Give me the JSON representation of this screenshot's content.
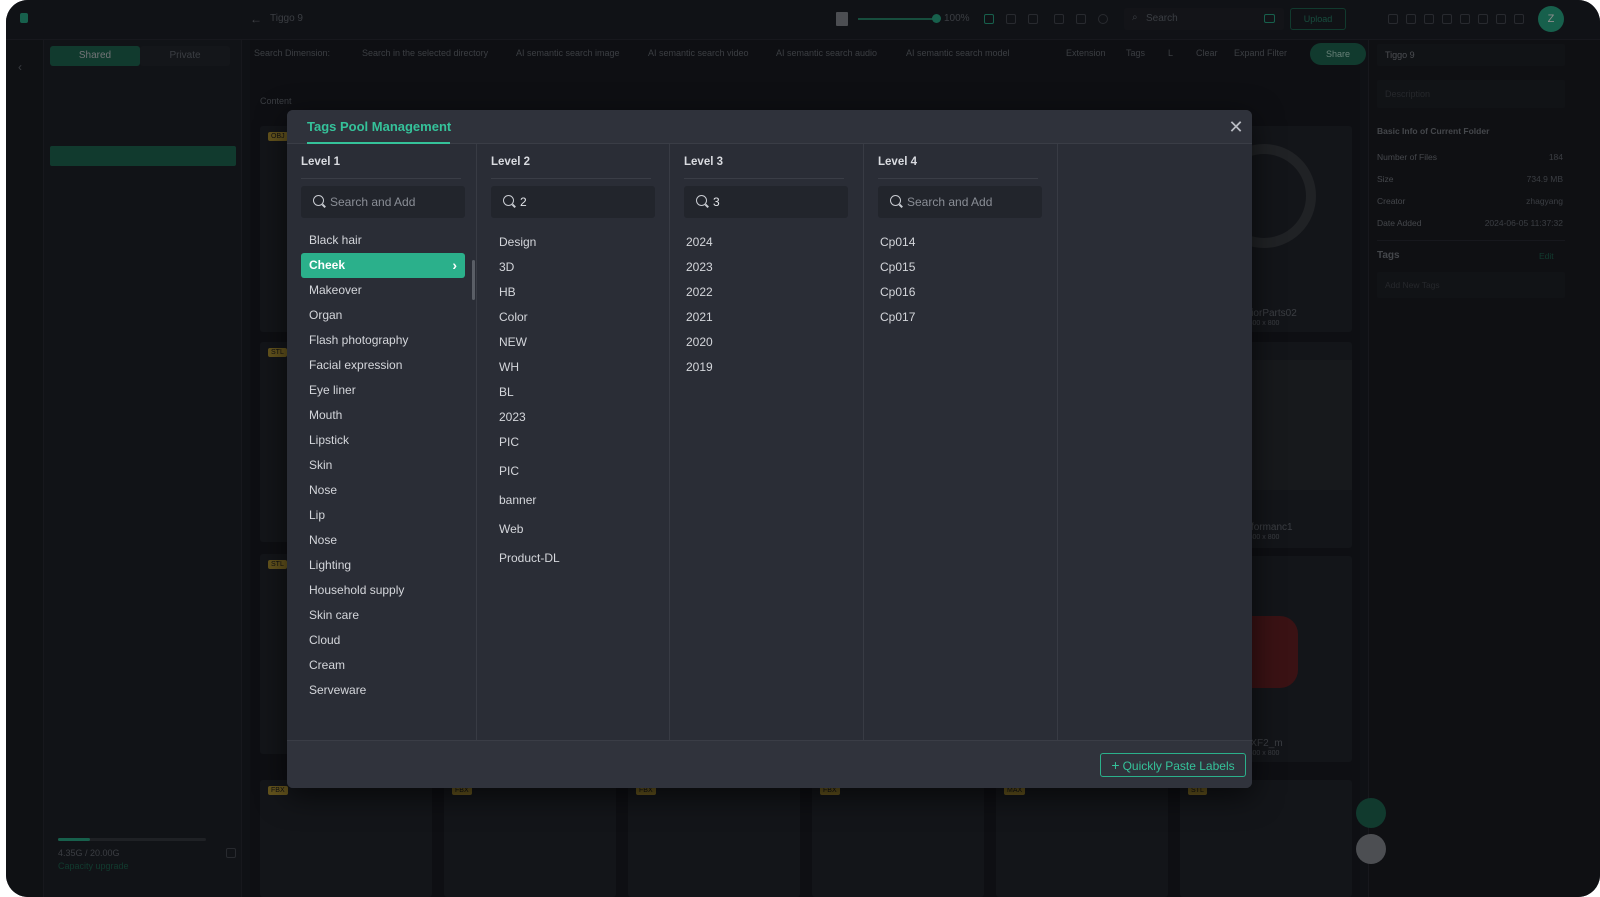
{
  "app": {
    "folder_title": "Tiggo 9",
    "zoom": "100%",
    "search_placeholder": "Search",
    "upload_label": "Upload",
    "avatar_letter": "Z",
    "tabs": {
      "shared": "Shared",
      "private": "Private"
    },
    "search_dimension_label": "Search Dimension:",
    "search_options": [
      "Search in the selected directory",
      "AI semantic search image",
      "AI semantic search video",
      "AI semantic search audio",
      "AI semantic search model"
    ],
    "filter_options": [
      "Extension",
      "Tags",
      "L"
    ],
    "clear_label": "Clear",
    "expand_filter_label": "Expand Filter",
    "share_label": "Share",
    "content_label": "Content",
    "storage_text": "4.35G / 20.00G",
    "storage_fraction": 0.218,
    "capacity_upgrade": "Capacity upgrade",
    "thumbnails": [
      {
        "name": "InteriorParts02",
        "size": "800 x 800"
      },
      {
        "name": "Performanc1",
        "size": "800 x 800"
      },
      {
        "name": "JXF2_m",
        "size": "800 x 800"
      }
    ],
    "thumb_badges": [
      "OBJ",
      "STL",
      "STL",
      "FBX",
      "FBX",
      "FBX",
      "FBX",
      "MAX",
      "STL"
    ]
  },
  "right_panel": {
    "folder_name": "Tiggo 9",
    "description_placeholder": "Description",
    "basic_info_title": "Basic Info of Current Folder",
    "info": [
      {
        "label": "Number of Files",
        "value": "184"
      },
      {
        "label": "Size",
        "value": "734.9 MB"
      },
      {
        "label": "Creator",
        "value": "zhagyang"
      },
      {
        "label": "Date Added",
        "value": "2024-06-05 11:37:32"
      }
    ],
    "tags_title": "Tags",
    "edit_label": "Edit",
    "add_tags_placeholder": "Add New Tags"
  },
  "modal": {
    "title": "Tags Pool Management",
    "paste_button": "Quickly Paste Labels",
    "columns": [
      {
        "header": "Level 1",
        "search_value": "",
        "search_placeholder": "Search and Add",
        "items": [
          "Black hair",
          "Cheek",
          "Makeover",
          "Organ",
          "Flash photography",
          "Facial expression",
          "Eye liner",
          "Mouth",
          "Lipstick",
          "Skin",
          "Nose",
          "Lip",
          "Nose",
          "Lighting",
          "Household supply",
          "Skin care",
          "Cloud",
          "Cream",
          "Serveware"
        ],
        "selected_index": 1
      },
      {
        "header": "Level 2",
        "search_value": "2",
        "search_placeholder": "Search and Add",
        "items": [
          "Design",
          "3D",
          "HB",
          "Color",
          "NEW",
          "WH",
          "BL",
          "2023",
          "PIC",
          "PIC",
          "banner",
          "Web",
          "Product-DL"
        ]
      },
      {
        "header": "Level 3",
        "search_value": "3",
        "search_placeholder": "Search and Add",
        "items": [
          "2024",
          "2023",
          "2022",
          "2021",
          "2020",
          "2019"
        ]
      },
      {
        "header": "Level 4",
        "search_value": "",
        "search_placeholder": "Search and Add",
        "items": [
          "Cp014",
          "Cp015",
          "Cp016",
          "Cp017"
        ]
      }
    ]
  }
}
